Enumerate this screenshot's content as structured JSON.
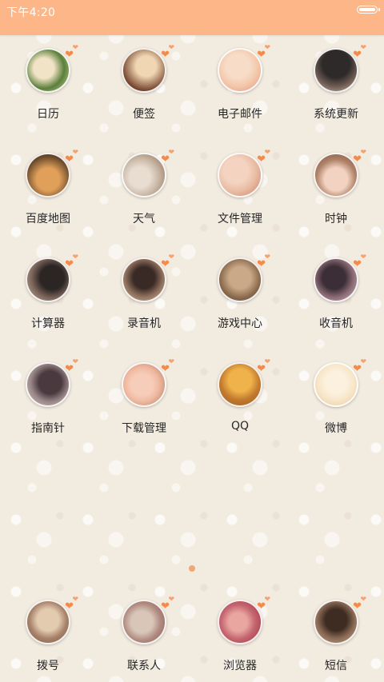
{
  "status_bar": {
    "time": "下午4:20",
    "battery_icon": "battery-full-icon",
    "color": "#fdb687"
  },
  "accent_color": "#f58b4a",
  "home_grid": [
    {
      "label": "日历",
      "icon": "calendar-icon",
      "colors": [
        "#5b7f3a",
        "#c9d9a6"
      ]
    },
    {
      "label": "便签",
      "icon": "notes-icon",
      "colors": [
        "#7a4a33",
        "#f0d6b2"
      ]
    },
    {
      "label": "电子邮件",
      "icon": "email-icon",
      "colors": [
        "#f2c7a8",
        "#e58f8b"
      ]
    },
    {
      "label": "系统更新",
      "icon": "system-update-icon",
      "colors": [
        "#2e2a2a",
        "#a08a7c"
      ]
    },
    {
      "label": "百度地图",
      "icon": "baidu-map-icon",
      "colors": [
        "#6b4a2a",
        "#e0a05a"
      ]
    },
    {
      "label": "天气",
      "icon": "weather-icon",
      "colors": [
        "#c9b8a6",
        "#8a6650"
      ]
    },
    {
      "label": "文件管理",
      "icon": "file-manager-icon",
      "colors": [
        "#e8b9a0",
        "#c47d63"
      ]
    },
    {
      "label": "时钟",
      "icon": "clock-icon",
      "colors": [
        "#7a4f3a",
        "#f2d3c1"
      ]
    },
    {
      "label": "计算器",
      "icon": "calculator-icon",
      "colors": [
        "#2b2524",
        "#cbb5a4"
      ]
    },
    {
      "label": "录音机",
      "icon": "recorder-icon",
      "colors": [
        "#3a2a26",
        "#d8c1a3"
      ]
    },
    {
      "label": "游戏中心",
      "icon": "game-center-icon",
      "colors": [
        "#8a6a4b",
        "#caa989"
      ]
    },
    {
      "label": "收音机",
      "icon": "radio-icon",
      "colors": [
        "#3b2e36",
        "#d7b8c0"
      ]
    },
    {
      "label": "指南针",
      "icon": "compass-icon",
      "colors": [
        "#4a3a3f",
        "#d9c8c2"
      ]
    },
    {
      "label": "下载管理",
      "icon": "download-manager-icon",
      "colors": [
        "#f0b9a1",
        "#b07860"
      ]
    },
    {
      "label": "QQ",
      "icon": "qq-icon",
      "colors": [
        "#9a5a1f",
        "#f0b24a"
      ]
    },
    {
      "label": "微博",
      "icon": "weibo-icon",
      "colors": [
        "#f7e5c7",
        "#e8c49a"
      ]
    }
  ],
  "page_indicator": {
    "pages": 1,
    "current": 1
  },
  "dock": [
    {
      "label": "拨号",
      "icon": "dialer-icon",
      "colors": [
        "#7b5a3d",
        "#e3cbb0"
      ]
    },
    {
      "label": "联系人",
      "icon": "contacts-icon",
      "colors": [
        "#d8c6b8",
        "#8a5a55"
      ]
    },
    {
      "label": "浏览器",
      "icon": "browser-icon",
      "colors": [
        "#9b2f3b",
        "#e9a5a0"
      ]
    },
    {
      "label": "短信",
      "icon": "messages-icon",
      "colors": [
        "#3e2c22",
        "#c9a88a"
      ]
    }
  ]
}
